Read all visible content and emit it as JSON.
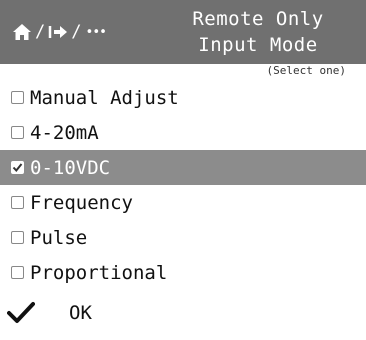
{
  "header": {
    "title_line1": "Remote Only",
    "title_line2": "Input Mode",
    "nav": {
      "home_icon": "home-icon",
      "separator": "/",
      "back_icon": "back-arrow-icon",
      "more": "•••"
    }
  },
  "hint": "(Select one)",
  "options": [
    {
      "label": "Manual Adjust",
      "checked": false
    },
    {
      "label": "4-20mA",
      "checked": false
    },
    {
      "label": "0-10VDC",
      "checked": true
    },
    {
      "label": "Frequency",
      "checked": false
    },
    {
      "label": "Pulse",
      "checked": false
    },
    {
      "label": "Proportional",
      "checked": false
    }
  ],
  "ok": {
    "label": "OK",
    "icon": "checkmark-icon"
  },
  "colors": {
    "header_bg": "#707070",
    "selected_bg": "#8c8c8c",
    "text": "#111111"
  }
}
